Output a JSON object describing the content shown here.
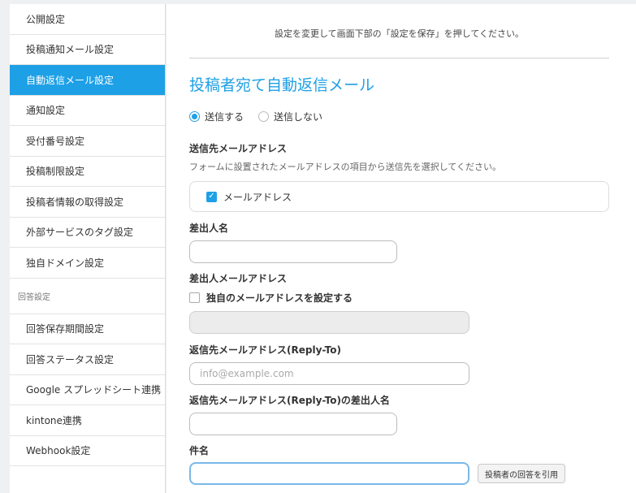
{
  "sidebar": {
    "items_top": [
      {
        "label": "公開設定"
      },
      {
        "label": "投稿通知メール設定"
      },
      {
        "label": "自動返信メール設定",
        "active": true
      },
      {
        "label": "通知設定"
      },
      {
        "label": "受付番号設定"
      },
      {
        "label": "投稿制限設定"
      },
      {
        "label": "投稿者情報の取得設定"
      },
      {
        "label": "外部サービスのタグ設定"
      },
      {
        "label": "独自ドメイン設定"
      }
    ],
    "section_label": "回答設定",
    "items_bottom": [
      {
        "label": "回答保存期間設定"
      },
      {
        "label": "回答ステータス設定"
      },
      {
        "label": "Google スプレッドシート連携"
      },
      {
        "label": "kintone連携"
      },
      {
        "label": "Webhook設定"
      }
    ]
  },
  "main": {
    "notice": "設定を変更して画面下部の「設定を保存」を押してください。",
    "title": "投稿者宛て自動返信メール",
    "send_option": {
      "yes": "送信する",
      "no": "送信しない",
      "selected": "yes"
    },
    "recipient": {
      "label": "送信先メールアドレス",
      "help": "フォームに設置されたメールアドレスの項目から送信先を選択してください。",
      "option": "メールアドレス",
      "checked": true
    },
    "sender_name": {
      "label": "差出人名",
      "value": ""
    },
    "sender_email": {
      "label": "差出人メールアドレス",
      "custom_label": "独自のメールアドレスを設定する",
      "custom_checked": false,
      "value": ""
    },
    "reply_to": {
      "label": "返信先メールアドレス(Reply-To)",
      "placeholder": "info@example.com",
      "value": ""
    },
    "reply_to_name": {
      "label": "返信先メールアドレス(Reply-To)の差出人名",
      "value": ""
    },
    "subject": {
      "label": "件名",
      "value": "",
      "quote_button": "投稿者の回答を引用"
    }
  },
  "colors": {
    "accent": "#1ea0e6"
  }
}
